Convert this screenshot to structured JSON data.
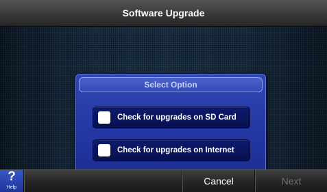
{
  "header": {
    "title": "Software Upgrade"
  },
  "dialog": {
    "title": "Select Option",
    "options": [
      {
        "label": "Check for upgrades on SD Card",
        "checked": false
      },
      {
        "label": "Check for upgrades on Internet",
        "checked": false
      }
    ]
  },
  "footer": {
    "help_symbol": "?",
    "help_label": "Help",
    "cancel_label": "Cancel",
    "next_label": "Next",
    "next_enabled": false
  },
  "colors": {
    "dialog_blue": "#2437a4",
    "option_navy": "#0e1a6e",
    "help_blue": "#3858c8",
    "disabled_text": "#6e6e6e"
  }
}
